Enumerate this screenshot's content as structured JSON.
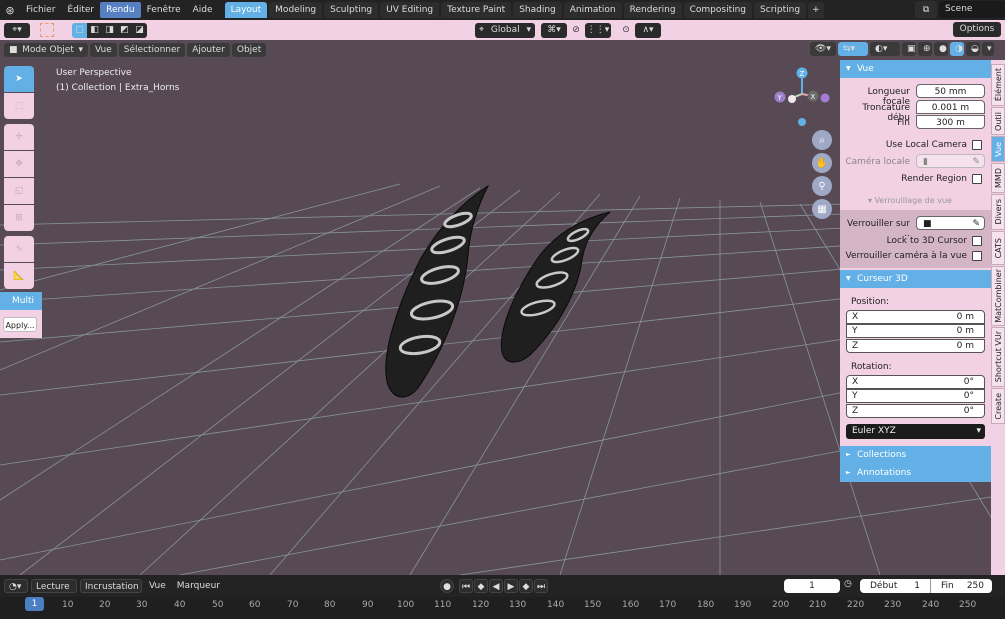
{
  "menu": {
    "items": [
      "Fichier",
      "Éditer",
      "Rendu",
      "Fenêtre",
      "Aide"
    ],
    "active": "Rendu"
  },
  "workspaces": [
    "Layout",
    "Modeling",
    "Sculpting",
    "UV Editing",
    "Texture Paint",
    "Shading",
    "Animation",
    "Rendering",
    "Compositing",
    "Scripting"
  ],
  "workspace_active": "Layout",
  "scene": {
    "name": "Scene"
  },
  "toolbar": {
    "orientation": "Global",
    "options": "Options"
  },
  "viewport_header": {
    "mode": "Mode Objet",
    "menus": [
      "Vue",
      "Sélectionner",
      "Ajouter",
      "Objet"
    ]
  },
  "viewport_info": {
    "perspective": "User Perspective",
    "collection": "(1) Collection | Extra_Horns"
  },
  "gizmo": {
    "x": "X",
    "y": "Y",
    "z": "Z"
  },
  "multi_panel": {
    "title": "Multi",
    "apply": "Apply..."
  },
  "npanel": {
    "vue_title": "Vue",
    "focal_label": "Longueur focale",
    "focal_value": "50 mm",
    "clip_start_label": "Troncature débu",
    "clip_start_value": "0.001 m",
    "clip_end_label": "Fin",
    "clip_end_value": "300 m",
    "local_camera_label": "Use Local Camera",
    "camera_locale_label": "Caméra locale",
    "render_region_label": "Render Region",
    "view_lock_title": "Verrouillage de vue",
    "lock_to_label": "Verrouiller sur ..",
    "lock_cursor_label": "Lock to 3D Cursor",
    "lock_camera_label": "Verrouiller caméra à la vue",
    "cursor_title": "Curseur 3D",
    "position_label": "Position:",
    "pos": [
      {
        "k": "X",
        "v": "0 m"
      },
      {
        "k": "Y",
        "v": "0 m"
      },
      {
        "k": "Z",
        "v": "0 m"
      }
    ],
    "rotation_label": "Rotation:",
    "rot": [
      {
        "k": "X",
        "v": "0°"
      },
      {
        "k": "Y",
        "v": "0°"
      },
      {
        "k": "Z",
        "v": "0°"
      }
    ],
    "rotation_mode": "Euler XYZ",
    "collections_title": "Collections",
    "annotations_title": "Annotations"
  },
  "side_tabs": [
    "Élément",
    "Outil",
    "Vue",
    "MMD",
    "Divers",
    "CATS",
    "MatCombiner",
    "Shortcut VUr",
    "Create"
  ],
  "side_tab_active": "Vue",
  "timeline": {
    "playback": "Lecture",
    "keying": "Incrustation",
    "view": "Vue",
    "markers": "Marqueur",
    "current_frame": "1",
    "start_label": "Début",
    "start": "1",
    "end_label": "Fin",
    "end": "250"
  },
  "ruler": [
    "1",
    "10",
    "20",
    "30",
    "40",
    "50",
    "60",
    "70",
    "80",
    "90",
    "100",
    "110",
    "120",
    "130",
    "140",
    "150",
    "160",
    "170",
    "180",
    "190",
    "200",
    "210",
    "220",
    "230",
    "240",
    "250"
  ],
  "colors": {
    "accent": "#62b0e6",
    "panel": "#f1d1e3",
    "viewport": "#574a54"
  }
}
